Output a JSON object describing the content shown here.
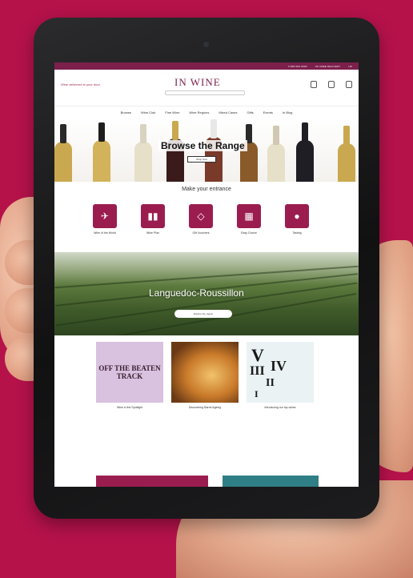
{
  "topbar": {
    "phone": "0 800 000 0000",
    "promo": "UK FREE DELIVERY",
    "flag": "UK"
  },
  "header": {
    "tagline": "Wine delivered to your door",
    "logo": "IN WINE",
    "search_placeholder": "",
    "icons": [
      "account-icon",
      "wishlist-icon",
      "basket-icon"
    ]
  },
  "nav": {
    "items": [
      "Browse",
      "Wine Club",
      "Fine Wine",
      "Wine Regions",
      "Mixed Cases",
      "Gifts",
      "Events",
      "In Blog"
    ]
  },
  "hero": {
    "title": "Browse the Range",
    "button": "Shop Now"
  },
  "entrance": {
    "title": "Make your entrance",
    "items": [
      {
        "icon": "globe-icon",
        "label": "Wine of the World"
      },
      {
        "icon": "bottles-icon",
        "label": "Wine Plan"
      },
      {
        "icon": "gift-icon",
        "label": "Gift Vouchers"
      },
      {
        "icon": "case-icon",
        "label": "Easy Choice"
      },
      {
        "icon": "wine-icon",
        "label": "Tasting"
      }
    ]
  },
  "region": {
    "title": "Languedoc-Roussillon",
    "button": "Explore the region"
  },
  "articles": [
    {
      "image_text": "OFF THE BEATEN TRACK",
      "caption": "Wine in the Spotlight"
    },
    {
      "image_text": "",
      "caption": "Discovering Barrel Ageing"
    },
    {
      "image_text": "V IV III II I",
      "caption": "Introducing our top wines"
    }
  ],
  "colors": {
    "brand": "#7c1f4b",
    "accent": "#9b1d4f",
    "background": "#b5124a"
  }
}
